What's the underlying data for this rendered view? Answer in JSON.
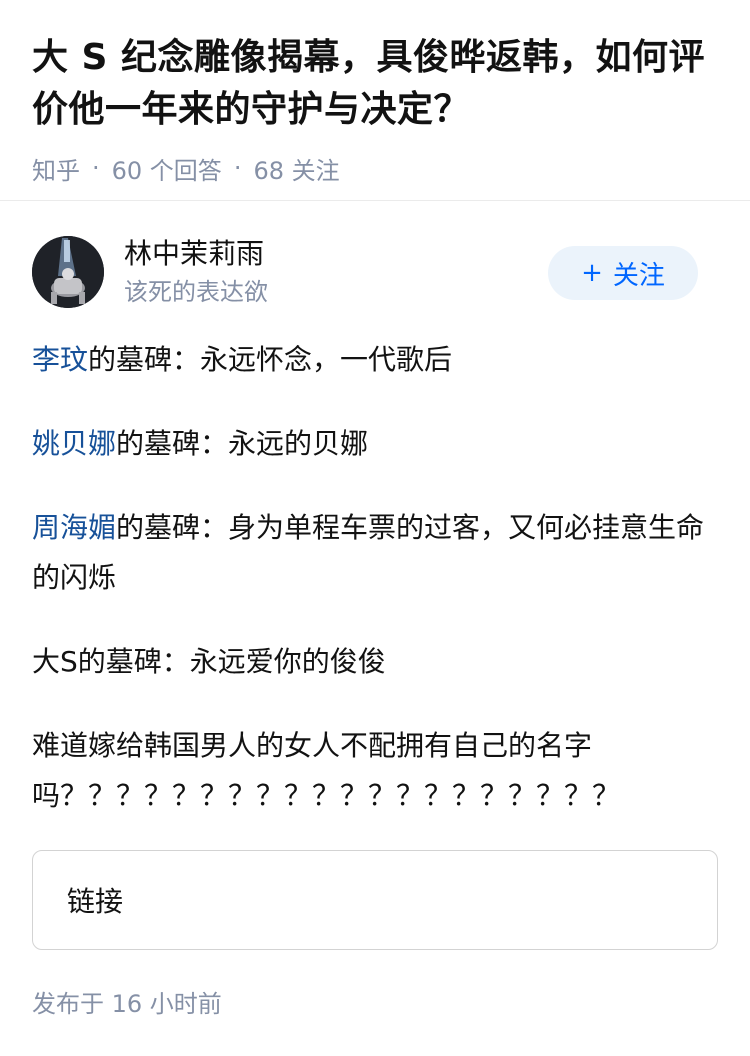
{
  "question": {
    "title": "大 S 纪念雕像揭幕，具俊晔返韩，如何评价他一年来的守护与决定？",
    "source": "知乎",
    "separator": "·",
    "answers": "60 个回答",
    "followers": "68 关注"
  },
  "author": {
    "name": "林中茉莉雨",
    "bio": "该死的表达欲",
    "avatar_icon": "avatar-photo-icon",
    "follow_plus": "+",
    "follow_label": "关注"
  },
  "answer": {
    "p1_link": "李玟",
    "p1_text": "的墓碑：永远怀念，一代歌后",
    "p2_link": "姚贝娜",
    "p2_text": "的墓碑：永远的贝娜",
    "p3_link": "周海媚",
    "p3_text": "的墓碑：身为单程车票的过客，又何必挂意生命的闪烁",
    "p4_text": "大S的墓碑：永远爱你的俊俊",
    "p5_text": "难道嫁给韩国男人的女人不配拥有自己的名字吗？？？？？？？？？？？？？？？？？？？？"
  },
  "link_card": {
    "label": "链接"
  },
  "publish": {
    "time": "发布于 16 小时前"
  },
  "colors": {
    "link": "#175199",
    "meta": "#8590a6",
    "follow_bg": "#ebf3fb",
    "follow_text": "#0066ff"
  }
}
